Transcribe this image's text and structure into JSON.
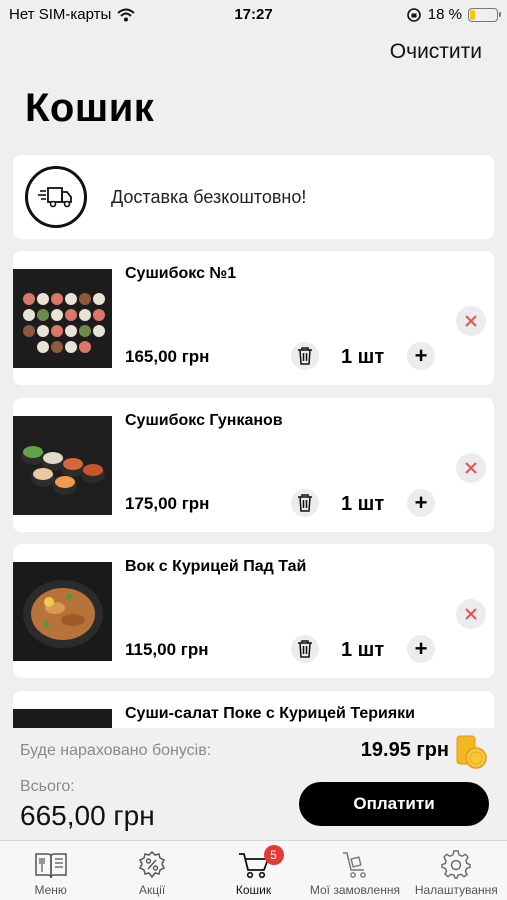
{
  "status_bar": {
    "carrier": "Нет SIM-карты",
    "time": "17:27",
    "battery_percent": "18 %",
    "battery_level": 0.18,
    "battery_color": "#f5c518"
  },
  "header": {
    "clear_label": "Очистити",
    "title": "Кошик"
  },
  "delivery": {
    "icon": "delivery-truck-icon",
    "text": "Доставка безкоштовно!"
  },
  "items": [
    {
      "name": "Сушибокс №1",
      "price": "165,00 грн",
      "qty": "1 шт",
      "image": "sushi-box-photo"
    },
    {
      "name": "Сушибокс Гунканов",
      "price": "175,00 грн",
      "qty": "1 шт",
      "image": "gunkan-box-photo"
    },
    {
      "name": "Вок с Курицей Пад Тай",
      "price": "115,00 грн",
      "qty": "1 шт",
      "image": "wok-photo"
    },
    {
      "name": "Суши-салат Поке с Курицей Терияки",
      "price": "",
      "qty": "",
      "image": "poke-photo"
    }
  ],
  "checkout": {
    "bonus_label": "Буде нараховано бонусів:",
    "bonus_value": "19.95 грн",
    "total_label": "Всього:",
    "total_value": "665,00 грн",
    "pay_label": "Оплатити"
  },
  "tabbar": {
    "tabs": [
      {
        "label": "Меню",
        "icon": "menu-book-icon"
      },
      {
        "label": "Акції",
        "icon": "promo-percent-icon"
      },
      {
        "label": "Кошик",
        "icon": "cart-icon",
        "badge": "5",
        "active": true
      },
      {
        "label": "Мої замовлення",
        "icon": "orders-cart-icon"
      },
      {
        "label": "Налаштування",
        "icon": "settings-gear-icon"
      }
    ]
  },
  "colors": {
    "accent": "#000000",
    "remove_icon": "#e05555",
    "badge": "#e53935",
    "background": "#efefef"
  }
}
